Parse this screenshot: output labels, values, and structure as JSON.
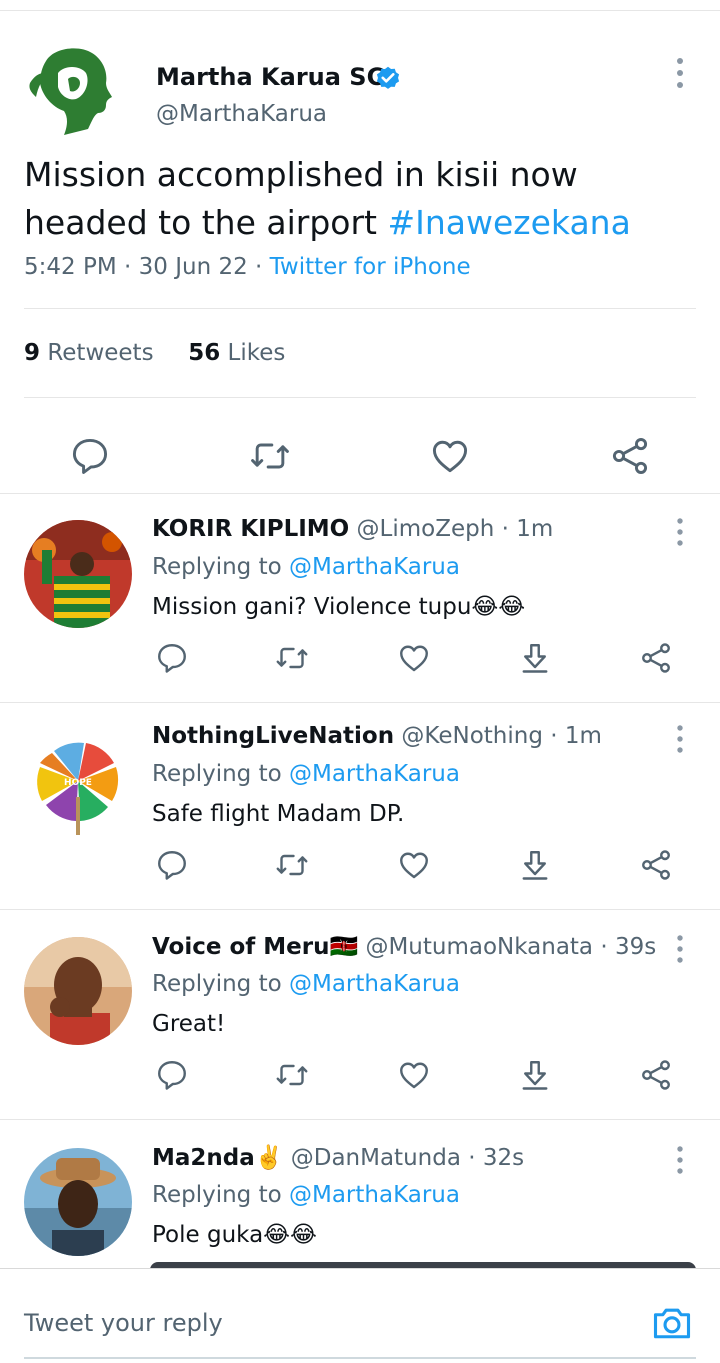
{
  "main_tweet": {
    "author_name": "Martha Karua SC",
    "author_handle": "@MarthaKarua",
    "text": "Mission accomplished in kisii now headed to the airport ",
    "hashtag": "#Inawezekana",
    "time": "5:42 PM",
    "date": "30 Jun 22",
    "separator": " · ",
    "source": "Twitter for iPhone",
    "retweets_count": "9",
    "retweets_label": "Retweets",
    "likes_count": "56",
    "likes_label": "Likes",
    "colors": {
      "accent": "#1d9bf0",
      "logo_green": "#2e7d32"
    }
  },
  "replies": [
    {
      "name": "KORIR KIPLIMO",
      "handle": "@LimoZeph",
      "time": "· 1m",
      "replying_prefix": "Replying to ",
      "replying_to": "@MarthaKarua",
      "text": "Mission gani? Violence tupu😂😂"
    },
    {
      "name": "NothingLiveNation",
      "handle": "@KeNothing",
      "time": "· 1m",
      "replying_prefix": "Replying to ",
      "replying_to": "@MarthaKarua",
      "text": "Safe flight Madam DP.",
      "avatar_text": "HOPE"
    },
    {
      "name": "Voice of Meru🇰🇪",
      "handle": "@MutumaoNkanata",
      "time": "· 39s",
      "replying_prefix": "Replying to ",
      "replying_to": "@MarthaKarua",
      "text": "Great!"
    },
    {
      "name": "Ma2nda✌️",
      "handle": "@DanMatunda",
      "time": "· 32s",
      "replying_prefix": "Replying to ",
      "replying_to": "@MarthaKarua",
      "text": "Pole guka😂😂"
    }
  ],
  "compose": {
    "placeholder": "Tweet your reply"
  },
  "icons": {
    "reply": "comment-icon",
    "retweet": "retweet-icon",
    "like": "heart-icon",
    "download": "download-icon",
    "share": "share-icon",
    "more": "more-vertical-icon",
    "camera": "camera-icon",
    "verified": "verified-badge-icon"
  }
}
